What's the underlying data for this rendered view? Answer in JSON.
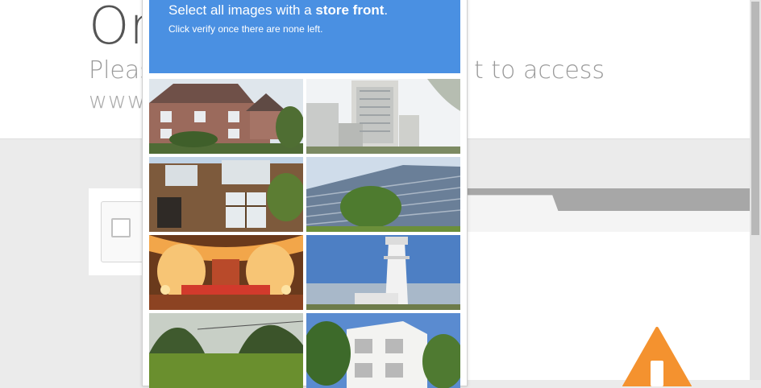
{
  "page": {
    "title_partial": "Or",
    "subtitle_left": "Pleas",
    "subtitle_right": "t to access",
    "url_partial": "www"
  },
  "challenge": {
    "instruction_prefix": "Select all images with a ",
    "instruction_target": "store front",
    "instruction_suffix": ".",
    "sub_instruction": "Click verify once there are none left.",
    "header_color": "#4a90e2",
    "tiles": [
      {
        "subject": "brick-house"
      },
      {
        "subject": "hotel-tower"
      },
      {
        "subject": "brick-window-facade"
      },
      {
        "subject": "office-block"
      },
      {
        "subject": "wedding-stage"
      },
      {
        "subject": "lighthouse"
      },
      {
        "subject": "mountain-field"
      },
      {
        "subject": "white-villa"
      }
    ]
  },
  "colors": {
    "accent": "#4a90e2",
    "warning": "#f4922f"
  },
  "icons": [
    "warning-icon",
    "checkbox-icon"
  ]
}
